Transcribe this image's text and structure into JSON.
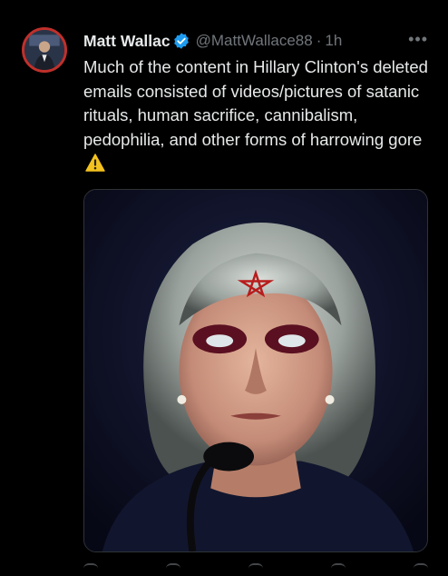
{
  "author": {
    "name": "Matt Wallac",
    "handle": "@MattWallace88",
    "time": "1h",
    "separator": "·",
    "verified_icon": "verified-badge-icon",
    "verified_color": "#1d9bf0"
  },
  "tweet": {
    "text": "Much of the content in Hillary Clinton's deleted emails consisted of videos/pictures of satanic rituals, human sacrifice, cannibalism, pedophilia, and other forms of harrowing gore",
    "emoji": "warning-icon"
  },
  "more_label": "•••",
  "colors": {
    "background": "#000000",
    "text": "#e7e9ea",
    "muted": "#71767b",
    "avatar_ring": "#c0302b"
  }
}
